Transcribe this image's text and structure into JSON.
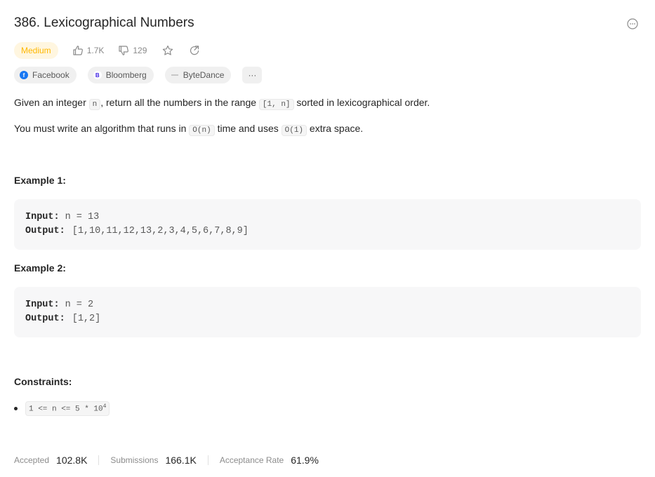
{
  "problem": {
    "title": "386. Lexicographical Numbers",
    "difficulty": "Medium",
    "likes": "1.7K",
    "dislikes": "129"
  },
  "tags": [
    {
      "label": "Facebook",
      "logo": "f",
      "color": "#1877f2"
    },
    {
      "label": "Bloomberg",
      "logo": "B",
      "color": "#ffffff"
    },
    {
      "label": "ByteDance",
      "logo": "",
      "color": "#ffffff"
    }
  ],
  "tags_more": "···",
  "description": {
    "p1_a": "Given an integer ",
    "p1_code1": "n",
    "p1_b": ", return all the numbers in the range ",
    "p1_code2": "[1, n]",
    "p1_c": " sorted in lexicographical order.",
    "p2_a": "You must write an algorithm that runs in ",
    "p2_code1": "O(n)",
    "p2_b": " time and uses ",
    "p2_code2": "O(1)",
    "p2_c": " extra space."
  },
  "examples": [
    {
      "title": "Example 1:",
      "input_label": "Input:",
      "input": "n = 13",
      "output_label": "Output:",
      "output": "[1,10,11,12,13,2,3,4,5,6,7,8,9]"
    },
    {
      "title": "Example 2:",
      "input_label": "Input:",
      "input": "n = 2",
      "output_label": "Output:",
      "output": "[1,2]"
    }
  ],
  "constraints": {
    "title": "Constraints:",
    "item_base": "1 <= n <= 5 * 10",
    "item_exp": "4"
  },
  "stats": {
    "accepted_label": "Accepted",
    "accepted": "102.8K",
    "submissions_label": "Submissions",
    "submissions": "166.1K",
    "rate_label": "Acceptance Rate",
    "rate": "61.9%"
  }
}
